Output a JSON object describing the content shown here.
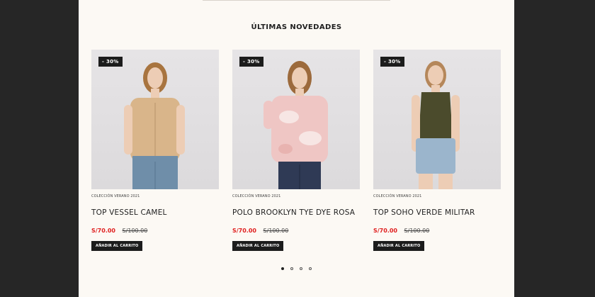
{
  "section": {
    "title": "ÚLTIMAS NOVEDADES"
  },
  "products": [
    {
      "badge": "- 30%",
      "collection": "COLECCIÓN VERANO 2021",
      "name": "TOP VESSEL CAMEL",
      "price_sale": "S/70.00",
      "price_old": "S/100.00",
      "cart_label": "AÑADIR AL CARRITO",
      "top_color": "#d9b58a",
      "pants_color": "#6f8ea9"
    },
    {
      "badge": "- 30%",
      "collection": "COLECCIÓN VERANO 2021",
      "name": "POLO BROOKLYN TYE DYE ROSA",
      "price_sale": "S/70.00",
      "price_old": "S/100.00",
      "cart_label": "AÑADIR AL CARRITO",
      "top_color": "#efc6c4",
      "pants_color": "#2f3a55"
    },
    {
      "badge": "- 30%",
      "collection": "COLECCIÓN VERANO 2021",
      "name": "TOP SOHO VERDE MILITAR",
      "price_sale": "S/70.00",
      "price_old": "S/100.00",
      "cart_label": "AÑADIR AL CARRITO",
      "top_color": "#4b4b2c",
      "pants_color": "#9bb5cc"
    }
  ],
  "carousel": {
    "pages": 4,
    "active_page": 1
  },
  "colors": {
    "sale_price": "#e02020",
    "badge_bg": "#1c1c1c",
    "page_bg": "#fcf9f4",
    "frame_bg": "#262626"
  }
}
